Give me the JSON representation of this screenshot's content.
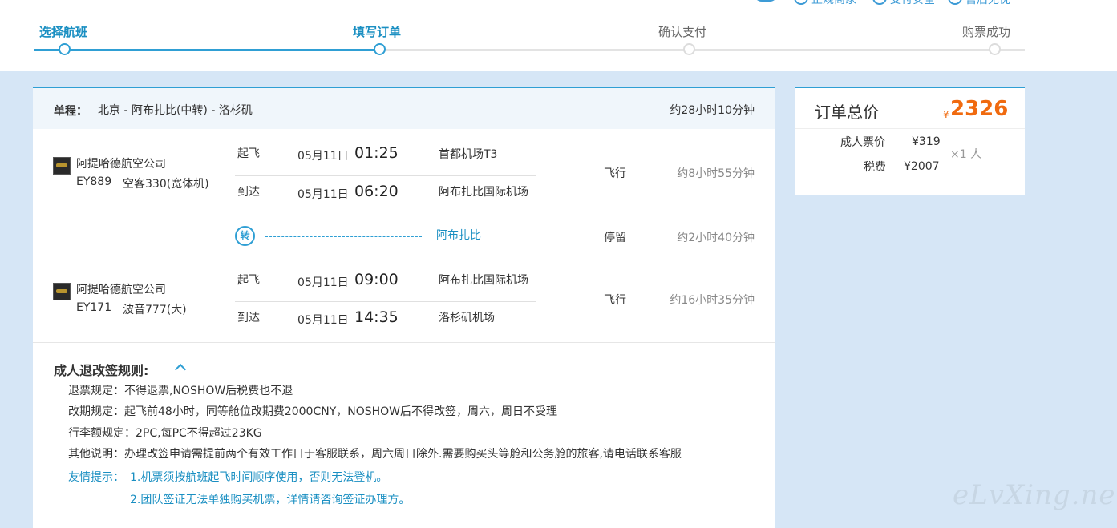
{
  "top_links": [
    {
      "label": "正规商家",
      "icon": "shield-check-icon"
    },
    {
      "label": "支付安全",
      "icon": "lock-shield-icon"
    },
    {
      "label": "售后无忧",
      "icon": "service-icon"
    }
  ],
  "steps": [
    {
      "label": "选择航班",
      "state": "done"
    },
    {
      "label": "填写订单",
      "state": "current"
    },
    {
      "label": "确认支付",
      "state": "todo"
    },
    {
      "label": "购票成功",
      "state": "todo"
    }
  ],
  "trip": {
    "label": "单程：",
    "route": "北京 - 阿布扎比(中转) - 洛杉矶",
    "total_duration": "约28小时10分钟",
    "legs": [
      {
        "airline": "阿提哈德航空公司",
        "flight_no": "EY889",
        "aircraft": "空客330(宽体机)",
        "dep_label": "起飞",
        "dep_date": "05月11日",
        "dep_time": "01:25",
        "dep_airport": "首都机场T3",
        "arr_label": "到达",
        "arr_date": "05月11日",
        "arr_time": "06:20",
        "arr_airport": "阿布扎比国际机场",
        "segment_type": "飞行",
        "duration": "约8小时55分钟"
      },
      {
        "airline": "阿提哈德航空公司",
        "flight_no": "EY171",
        "aircraft": "波音777(大)",
        "dep_label": "起飞",
        "dep_date": "05月11日",
        "dep_time": "09:00",
        "dep_airport": "阿布扎比国际机场",
        "arr_label": "到达",
        "arr_date": "05月11日",
        "arr_time": "14:35",
        "arr_airport": "洛杉矶机场",
        "segment_type": "飞行",
        "duration": "约16小时35分钟"
      }
    ],
    "transfer": {
      "icon_text": "转",
      "city": "阿布扎比",
      "segment_type": "停留",
      "duration": "约2小时40分钟"
    }
  },
  "rules": {
    "title": "成人退改签规则:",
    "items": [
      "退票规定：不得退票,NOSHOW后税费也不退",
      "改期规定：起飞前48小时，同等舱位改期费2000CNY，NOSHOW后不得改签，周六，周日不受理",
      "行李额规定：2PC,每PC不得超过23KG",
      "其他说明：办理改签申请需提前两个有效工作日于客服联系，周六周日除外.需要购买头等舱和公务舱的旅客,请电话联系客服"
    ],
    "tip_label": "友情提示：",
    "tips": [
      "1.机票须按航班起飞时间顺序使用，否则无法登机。",
      "2.团队签证无法单独购买机票，详情请咨询签证办理方。"
    ]
  },
  "order_total": {
    "title": "订单总价",
    "currency": "¥",
    "amount": "2326",
    "adult_fare_label": "成人票价",
    "adult_fare": "¥319",
    "multiplier": "×1 人",
    "tax_label": "税费",
    "tax": "¥2007"
  },
  "watermark": "eLvXing.net",
  "colors": {
    "accent": "#2f9fd4",
    "price": "#f06a0f",
    "page_bg": "#d6e6f6"
  }
}
